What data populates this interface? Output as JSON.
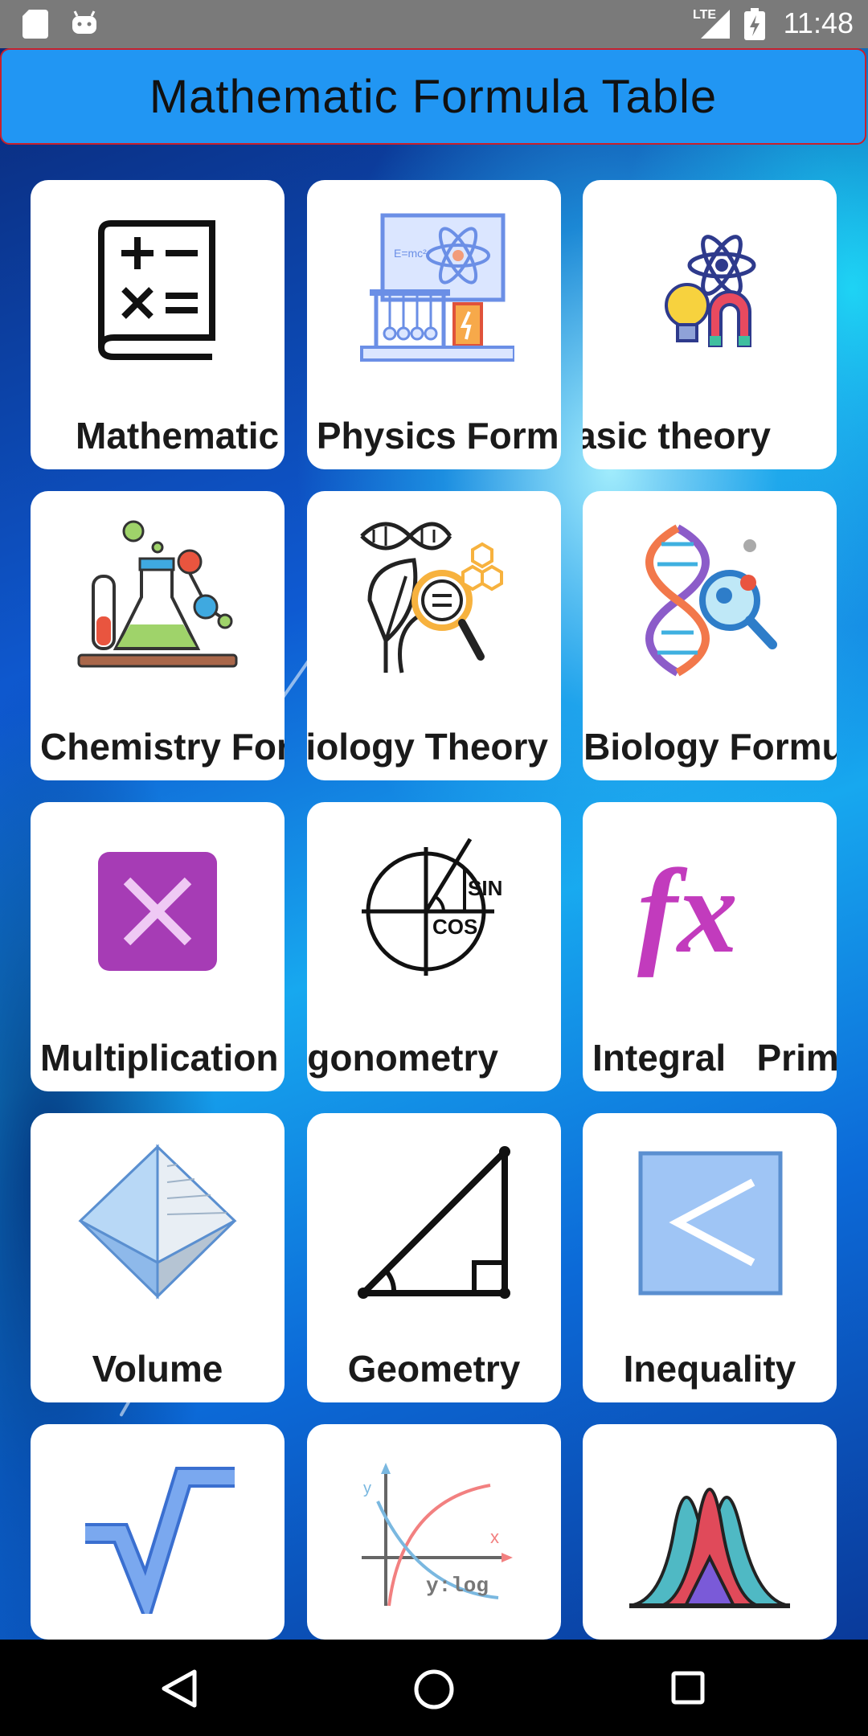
{
  "status_bar": {
    "time": "11:48",
    "network": "LTE",
    "icons": [
      "sd-card-icon",
      "android-icon",
      "signal-icon",
      "battery-charging-icon"
    ]
  },
  "app_bar": {
    "title": "Mathematic Formula Table"
  },
  "cards": [
    {
      "label": "Mathematic",
      "icon": "math-book-icon"
    },
    {
      "label": "Physics Formula",
      "icon": "physics-board-icon"
    },
    {
      "label": "Basic theory",
      "icon": "science-theory-icon"
    },
    {
      "label": "Chemistry Formula",
      "icon": "chemistry-flask-icon"
    },
    {
      "label": "Biology Theory",
      "icon": "biology-dna-leaf-icon"
    },
    {
      "label": "Biology Formula",
      "icon": "dna-search-icon"
    },
    {
      "label": "Multiplication",
      "icon": "multiplication-icon"
    },
    {
      "label": "Trigonometry",
      "icon": "trigonometry-icon"
    },
    {
      "label": "Integral   Primitive",
      "icon": "function-fx-icon"
    },
    {
      "label": "Volume",
      "icon": "volume-octahedron-icon"
    },
    {
      "label": "Geometry",
      "icon": "right-triangle-icon"
    },
    {
      "label": "Inequality",
      "icon": "less-than-icon"
    },
    {
      "label": "",
      "icon": "square-root-icon"
    },
    {
      "label": "",
      "icon": "log-graph-icon"
    },
    {
      "label": "",
      "icon": "distribution-curves-icon"
    }
  ],
  "nav_bar": {
    "buttons": [
      "back-icon",
      "home-icon",
      "recents-icon"
    ]
  },
  "colors": {
    "app_bar": "#2196f3",
    "app_bar_border": "#c8202c",
    "status_bar": "#7a7a7a",
    "nav_bar": "#000000"
  }
}
